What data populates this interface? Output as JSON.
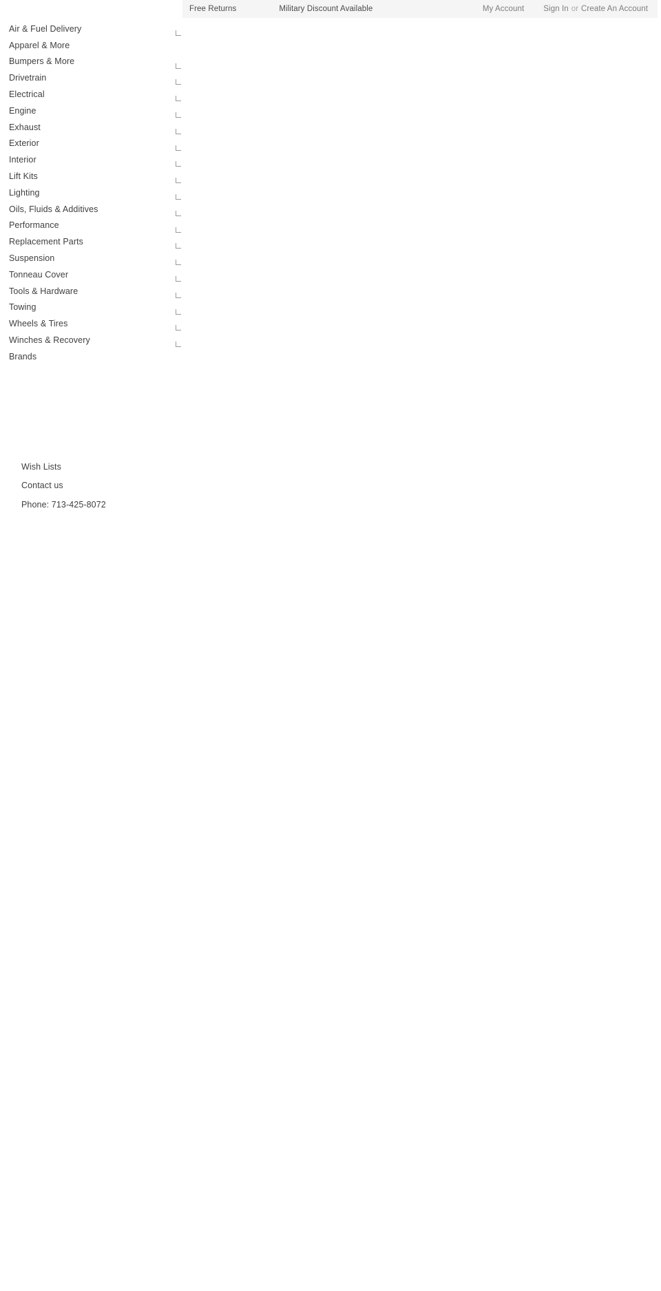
{
  "topbar": {
    "promos": [
      {
        "label": "Free Returns"
      },
      {
        "label": "Military Discount Available"
      }
    ],
    "account": {
      "my_account_label": "My Account",
      "sign_in_label": "Sign In",
      "or_label": "or",
      "create_account_label": "Create An Account"
    },
    "background_color": "#f5f5f5",
    "text_color": "#4a4a4a",
    "muted_text_color": "#a8a8a8"
  },
  "main_nav": {
    "items": [
      {
        "label": "Air & Fuel Delivery",
        "has_submenu_marker": true
      },
      {
        "label": "Apparel & More",
        "has_submenu_marker": false
      },
      {
        "label": "Bumpers & More",
        "has_submenu_marker": true
      },
      {
        "label": "Drivetrain",
        "has_submenu_marker": true
      },
      {
        "label": "Electrical",
        "has_submenu_marker": true
      },
      {
        "label": "Engine",
        "has_submenu_marker": true
      },
      {
        "label": "Exhaust",
        "has_submenu_marker": true
      },
      {
        "label": "Exterior",
        "has_submenu_marker": true
      },
      {
        "label": "Interior",
        "has_submenu_marker": true
      },
      {
        "label": "Lift Kits",
        "has_submenu_marker": true
      },
      {
        "label": "Lighting",
        "has_submenu_marker": true
      },
      {
        "label": "Oils, Fluids & Additives",
        "has_submenu_marker": true
      },
      {
        "label": "Performance",
        "has_submenu_marker": true
      },
      {
        "label": "Replacement Parts",
        "has_submenu_marker": true
      },
      {
        "label": "Suspension",
        "has_submenu_marker": true
      },
      {
        "label": "Tonneau Cover",
        "has_submenu_marker": true
      },
      {
        "label": "Tools & Hardware",
        "has_submenu_marker": true
      },
      {
        "label": "Towing",
        "has_submenu_marker": true
      },
      {
        "label": "Wheels & Tires",
        "has_submenu_marker": true
      },
      {
        "label": "Winches & Recovery",
        "has_submenu_marker": true
      },
      {
        "label": "Brands",
        "has_submenu_marker": false
      }
    ],
    "text_color": "#3f3f3f"
  },
  "utility_links": {
    "items": [
      {
        "label": "Wish Lists"
      },
      {
        "label": "Contact us"
      },
      {
        "label": "Phone: 713-425-8072"
      }
    ]
  },
  "page": {
    "background_color": "#ffffff"
  }
}
